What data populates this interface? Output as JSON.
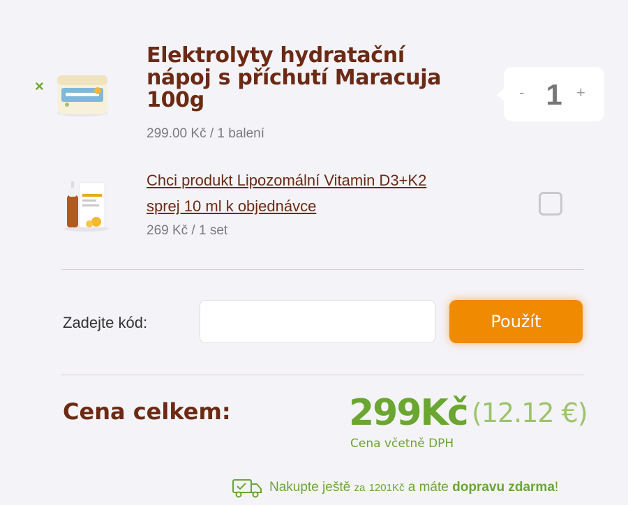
{
  "items": [
    {
      "title_line1": "Elektrolyty hydratační",
      "title_line2": "nápoj s příchutí Maracuja",
      "title_line3": "100g",
      "price": "299.00 Kč / 1 balení",
      "quantity": "1",
      "remove_glyph": "×",
      "minus_label": "-",
      "plus_label": "+"
    }
  ],
  "upsell": {
    "line1": "Chci produkt Lipozomální Vitamin D3+K2",
    "line2": "sprej 10 ml k objednávce",
    "price": "269 Kč / 1 set"
  },
  "coupon": {
    "label": "Zadejte kód:",
    "value": "",
    "button": "Použít"
  },
  "total": {
    "label": "Cena celkem:",
    "value": "299Kč",
    "eur": "(12.12 €)",
    "vat_note": "Cena včetně DPH"
  },
  "shipping": {
    "prefix": "Nakupte ještě",
    "za": "za",
    "amount": "1201Kč",
    "middle": "a máte",
    "bold": "dopravu zdarma",
    "suffix": "!"
  },
  "colors": {
    "brand_brown": "#6b2a14",
    "accent_green": "#6aa630",
    "button_orange": "#f08a00"
  }
}
